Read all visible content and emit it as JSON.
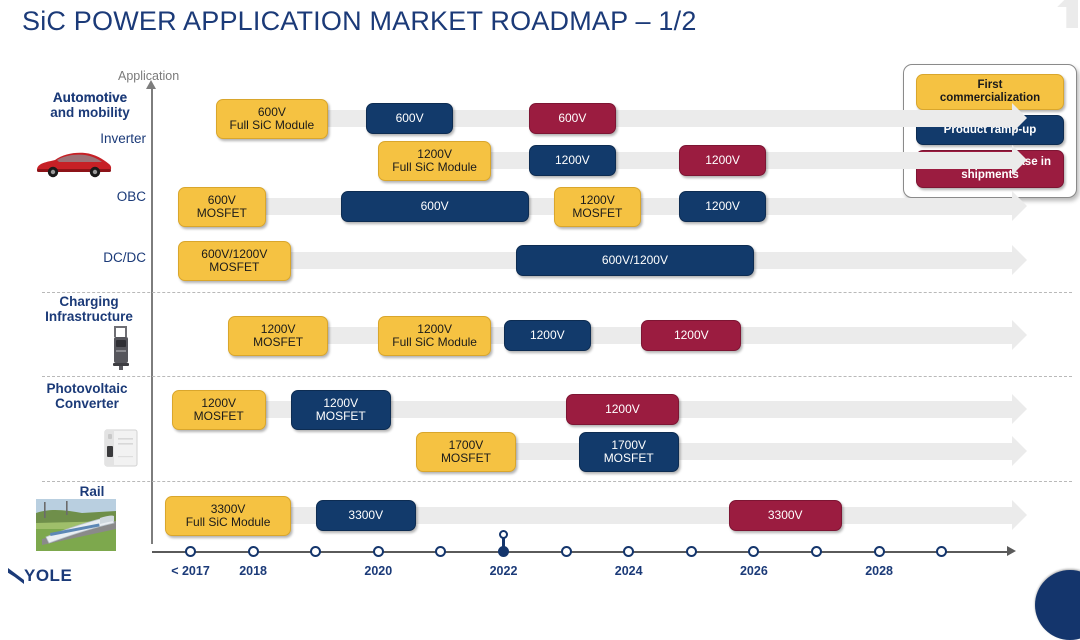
{
  "title": "SiC POWER APPLICATION MARKET ROADMAP – 1/2",
  "axis_caption": "Application",
  "brand": "YOLE",
  "legend": {
    "first": "First\ncommercialization",
    "first_l1": "First",
    "first_l2": "commercialization",
    "ramp": "Product ramp-up",
    "increase_l1": "Significant increase in",
    "increase_l2": "shipments"
  },
  "colors": {
    "yellow": "#F5C242",
    "blue": "#123A6B",
    "maroon": "#9B1C40",
    "arrow": "#EBEBEB",
    "title": "#1B3A78",
    "axis": "#5A5A5A"
  },
  "groups": [
    {
      "name": "Automotive and mobility",
      "line1": "Automotive",
      "line2": "and mobility",
      "icon": "red-car-icon"
    },
    {
      "name": "Charging Infrastructure",
      "line1": "Charging",
      "line2": "Infrastructure",
      "icon": "ev-charger-icon"
    },
    {
      "name": "Photovoltaic Converter",
      "line1": "Photovoltaic",
      "line2": "Converter",
      "icon": "pv-inverter-icon"
    },
    {
      "name": "Rail",
      "line1": "Rail",
      "line2": "",
      "icon": "train-icon"
    }
  ],
  "sub_labels": {
    "inverter": "Inverter",
    "obc": "OBC",
    "dcdc": "DC/DC"
  },
  "chart_data": {
    "type": "table",
    "title": "SiC POWER APPLICATION MARKET ROADMAP – 1/2",
    "xlabel": "",
    "ylabel": "Application",
    "x_ticks": [
      "< 2017",
      "2018",
      "2020",
      "2022",
      "2024",
      "2026",
      "2028"
    ],
    "x_tick_count": 13,
    "current_year_marker": "2022",
    "legend_entries": [
      "First commercialization",
      "Product ramp-up",
      "Significant increase in shipments"
    ],
    "rows": [
      {
        "group": "Automotive and mobility",
        "sub": "Inverter",
        "items": [
          {
            "l1": "600V",
            "l2": "Full SiC Module",
            "stage": "first",
            "start_year": "2017.4",
            "end_year": "2019.2"
          },
          {
            "l1": "600V",
            "l2": "",
            "stage": "ramp",
            "start_year": "2019.8",
            "end_year": "2021.2"
          },
          {
            "l1": "600V",
            "l2": "",
            "stage": "increase",
            "start_year": "2022.4",
            "end_year": "2023.8"
          }
        ]
      },
      {
        "group": "Automotive and mobility",
        "sub": "Inverter",
        "items": [
          {
            "l1": "1200V",
            "l2": "Full SiC Module",
            "stage": "first",
            "start_year": "2020.0",
            "end_year": "2021.8"
          },
          {
            "l1": "1200V",
            "l2": "",
            "stage": "ramp",
            "start_year": "2022.4",
            "end_year": "2023.8"
          },
          {
            "l1": "1200V",
            "l2": "",
            "stage": "increase",
            "start_year": "2024.8",
            "end_year": "2026.2"
          }
        ]
      },
      {
        "group": "Automotive and mobility",
        "sub": "OBC",
        "items": [
          {
            "l1": "600V",
            "l2": "MOSFET",
            "stage": "first",
            "start_year": "2016.8",
            "end_year": "2018.2"
          },
          {
            "l1": "600V",
            "l2": "",
            "stage": "ramp",
            "start_year": "2019.4",
            "end_year": "2022.4"
          },
          {
            "l1": "1200V",
            "l2": "MOSFET",
            "stage": "first",
            "start_year": "2022.8",
            "end_year": "2024.2"
          },
          {
            "l1": "1200V",
            "l2": "",
            "stage": "ramp",
            "start_year": "2024.8",
            "end_year": "2026.2"
          }
        ]
      },
      {
        "group": "Automotive and mobility",
        "sub": "DC/DC",
        "items": [
          {
            "l1": "600V/1200V",
            "l2": "MOSFET",
            "stage": "first",
            "start_year": "2016.8",
            "end_year": "2018.6"
          },
          {
            "l1": "600V/1200V",
            "l2": "",
            "stage": "ramp",
            "start_year": "2022.2",
            "end_year": "2026.0"
          }
        ]
      },
      {
        "group": "Charging Infrastructure",
        "sub": "",
        "items": [
          {
            "l1": "1200V",
            "l2": "MOSFET",
            "stage": "first",
            "start_year": "2017.6",
            "end_year": "2019.2"
          },
          {
            "l1": "1200V",
            "l2": "Full SiC Module",
            "stage": "first",
            "start_year": "2020.0",
            "end_year": "2021.8"
          },
          {
            "l1": "1200V",
            "l2": "",
            "stage": "ramp",
            "start_year": "2022.0",
            "end_year": "2023.4"
          },
          {
            "l1": "1200V",
            "l2": "",
            "stage": "increase",
            "start_year": "2024.2",
            "end_year": "2025.8"
          }
        ]
      },
      {
        "group": "Photovoltaic Converter",
        "sub": "",
        "items": [
          {
            "l1": "1200V",
            "l2": "MOSFET",
            "stage": "first",
            "start_year": "2016.7",
            "end_year": "2018.2"
          },
          {
            "l1": "1200V",
            "l2": "MOSFET",
            "stage": "ramp",
            "start_year": "2018.6",
            "end_year": "2020.2"
          },
          {
            "l1": "1200V",
            "l2": "",
            "stage": "increase",
            "start_year": "2023.0",
            "end_year": "2024.8"
          }
        ]
      },
      {
        "group": "Photovoltaic Converter",
        "sub": "",
        "items": [
          {
            "l1": "1700V",
            "l2": "MOSFET",
            "stage": "first",
            "start_year": "2020.6",
            "end_year": "2022.2"
          },
          {
            "l1": "1700V",
            "l2": "MOSFET",
            "stage": "ramp",
            "start_year": "2023.2",
            "end_year": "2024.8"
          }
        ]
      },
      {
        "group": "Rail",
        "sub": "",
        "items": [
          {
            "l1": "3300V",
            "l2": "Full SiC Module",
            "stage": "first",
            "start_year": "2016.6",
            "end_year": "2018.6"
          },
          {
            "l1": "3300V",
            "l2": "",
            "stage": "ramp",
            "start_year": "2019.0",
            "end_year": "2020.6"
          },
          {
            "l1": "3300V",
            "l2": "",
            "stage": "increase",
            "start_year": "2025.6",
            "end_year": "2027.4"
          }
        ]
      }
    ]
  }
}
